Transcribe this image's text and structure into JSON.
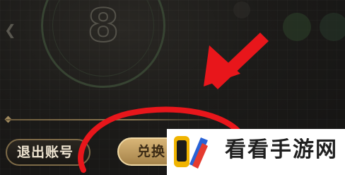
{
  "timer": {
    "digit": "8"
  },
  "nav": {
    "arrow": "❮"
  },
  "buttons": {
    "logout_label": "退出账号",
    "redeem_label": "兑换"
  },
  "watermark": {
    "text": "看看手游网"
  },
  "colors": {
    "annotation_red": "#e8161b",
    "gold": "#d8b577",
    "background": "#1a1917"
  }
}
